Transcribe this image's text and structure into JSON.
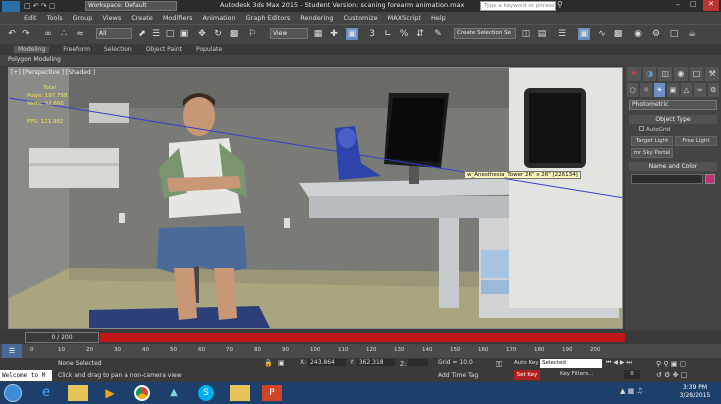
{
  "titlebar": {
    "app_icon": "MAX",
    "workspace": "Workspace: Default",
    "title": "Autodesk 3ds Max 2015  -  Student Version:  scaning forearm animation.max",
    "search_placeholder": "Type a keyword or phrase"
  },
  "menu": [
    "Edit",
    "Tools",
    "Group",
    "Views",
    "Create",
    "Modifiers",
    "Animation",
    "Graph Editors",
    "Rendering",
    "Customize",
    "MAXScript",
    "Help"
  ],
  "toolbar": {
    "filter": "All",
    "ref_coord": "View",
    "selection_set": "Create Selection Se"
  },
  "ribbon": {
    "tabs": [
      "Modeling",
      "Freeform",
      "Selection",
      "Object Paint",
      "Populate"
    ],
    "sub": "Polygon Modeling"
  },
  "viewport": {
    "label": "[+] [Perspective ] [Shaded ]",
    "stats": {
      "total": "Total",
      "polys_label": "Polys:",
      "polys_value": "197,758",
      "verts_label": "Verts:",
      "verts_value": "92,666",
      "fps_label": "FPS:",
      "fps_value": "121.982"
    },
    "tooltip": "w_Anesthesia_Tower 26\" x 26\" [226134]"
  },
  "cmdpanel": {
    "dropdown": "Photometric",
    "rollout_type": "Object Type",
    "autogrid": "AutoGrid",
    "buttons": [
      "Target Light",
      "Free Light",
      "mr Sky Portal"
    ],
    "rollout_name": "Name and Color",
    "color": "#c0307a"
  },
  "timeline": {
    "frame": "0 / 200"
  },
  "track": {
    "ticks": [
      "0",
      "10",
      "20",
      "30",
      "40",
      "50",
      "60",
      "70",
      "80",
      "90",
      "100",
      "110",
      "120",
      "130",
      "140",
      "150",
      "160",
      "170",
      "180",
      "190",
      "200"
    ]
  },
  "status": {
    "script_label": "Welcome to M",
    "selected": "None Selected",
    "prompt": "Click and drag to pan a non-camera view",
    "x_label": "X:",
    "x_value": "243.864",
    "y_label": "Y:",
    "y_value": "362.318",
    "z_label": "Z:",
    "grid": "Grid = 10.0",
    "add_time_tag": "Add Time Tag",
    "auto_key": "Auto Key",
    "set_key": "Set Key",
    "selected_dropdown": "Selected",
    "key_filters": "Key Filters..."
  },
  "taskbar": {
    "time": "3:39 PM",
    "date": "3/28/2015"
  }
}
